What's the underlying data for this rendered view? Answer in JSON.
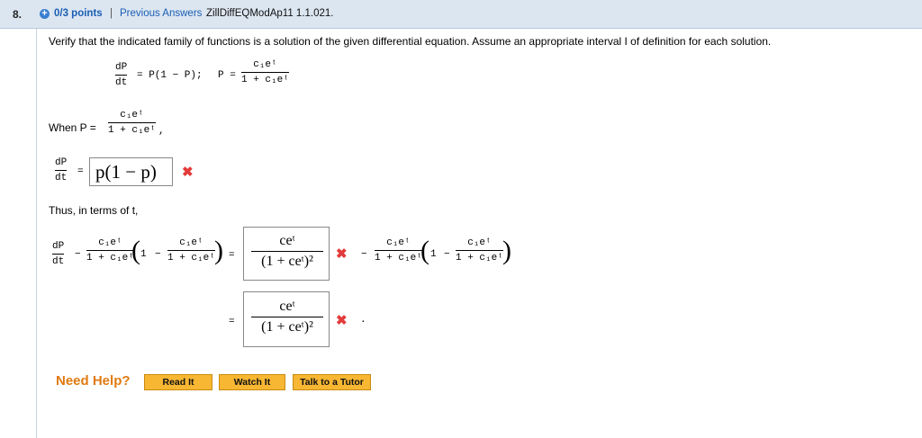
{
  "header": {
    "number": "8.",
    "points": "0/3 points",
    "separator": "|",
    "previous_answers": "Previous Answers",
    "problem_id": "ZillDiffEQModAp11 1.1.021."
  },
  "question": {
    "instruction": "Verify that the indicated family of functions is a solution of the given differential equation. Assume an appropriate interval I of definition for each solution.",
    "dP": "dP",
    "dt": "dt",
    "equation_rhs": "= P(1 − P);",
    "p_eq": "P =",
    "c1et": "c₁eᵗ",
    "one_plus_c1et": "1 + c₁eᵗ",
    "when_p": "When P =",
    "comma": ",",
    "equals": "=",
    "thus": "Thus, in terms of t,",
    "minus": "−",
    "dot": "."
  },
  "answers": {
    "answer1": "p(1 − p)",
    "answer2_num": "ceᵗ",
    "answer2_den": "(1 + ceᵗ)²",
    "answer3_num": "ceᵗ",
    "answer3_den": "(1 + ceᵗ)²",
    "incorrect_mark": "✖"
  },
  "help": {
    "label": "Need Help?",
    "buttons": [
      "Read It",
      "Watch It",
      "Talk to a Tutor"
    ]
  },
  "colors": {
    "header_bg": "#dce6f1",
    "link": "#1a5eb3",
    "incorrect": "#e23b3b",
    "help": "#e07a12",
    "button": "#f8b733"
  }
}
